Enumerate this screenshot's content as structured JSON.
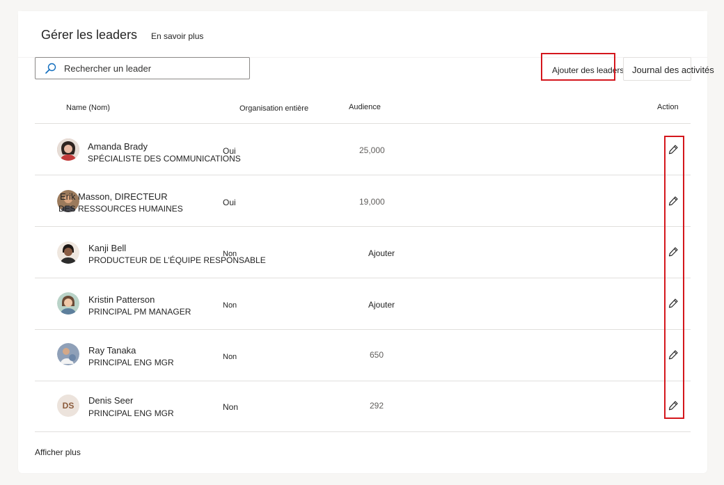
{
  "header": {
    "title": "Gérer les leaders",
    "learn_more": "En savoir plus"
  },
  "search": {
    "placeholder": "Rechercher un leader",
    "icon": "search-icon"
  },
  "toolbar": {
    "add_label": "Ajouter des leaders",
    "journal_label": "Journal des activités"
  },
  "table": {
    "columns": {
      "name": "Name (Nom)",
      "org": "Organisation entière",
      "audience": "Audience",
      "action": "Action"
    },
    "rows": [
      {
        "name": "Amanda Brady",
        "role": "SPÉCIALISTE DES COMMUNICATIONS",
        "org": "Oui",
        "audience": "25,000",
        "avatar": "photo",
        "avatar_color": "#d9a8a0"
      },
      {
        "name": "Erik Masson, DIRECTEUR",
        "role": "DES RESSOURCES HUMAINES",
        "org": "Oui",
        "audience": "19,000",
        "avatar": "photo",
        "avatar_color": "#8b6a4f"
      },
      {
        "name": "Kanji Bell",
        "role": "PRODUCTEUR DE L’ÉQUIPE RESPONSABLE",
        "org": "Non",
        "audience": "Ajouter",
        "avatar": "photo",
        "avatar_color": "#5a3e32"
      },
      {
        "name": "Kristin Patterson",
        "role": "PRINCIPAL PM MANAGER",
        "org": "Non",
        "audience": "Ajouter",
        "avatar": "photo",
        "avatar_color": "#a6c4b8"
      },
      {
        "name": "Ray Tanaka",
        "role": "PRINCIPAL ENG MGR",
        "org": "Non",
        "audience": "650",
        "avatar": "photo",
        "avatar_color": "#7f8fa8"
      },
      {
        "name": "Denis Seer",
        "role": "PRINCIPAL ENG MGR",
        "org": "Non",
        "audience": "292",
        "avatar": "initials",
        "initials": "DS",
        "avatar_color": "#ece3dc"
      }
    ]
  },
  "footer": {
    "show_more": "Afficher plus"
  },
  "colors": {
    "highlight": "#d4161c",
    "search_icon": "#0f6cbd"
  }
}
